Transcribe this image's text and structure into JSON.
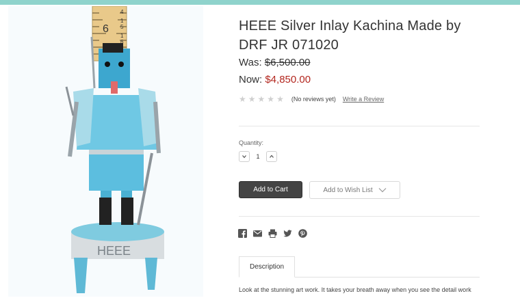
{
  "colors": {
    "accent_bar": "#8fd3cc",
    "sale_price": "#b3261e",
    "button_dark": "#444444"
  },
  "product": {
    "title_line1": "HEEE Silver Inlay Kachina Made by",
    "title_line2": "DRF JR 071020",
    "price_was_label": "Was: ",
    "price_was_value": "$6,500.00",
    "price_now_label": "Now: ",
    "price_now_value": "$4,850.00",
    "rating_stars": 0,
    "reviews_text": "(No reviews yet)",
    "write_review_label": "Write a Review",
    "image_base_inscription": "HEEE"
  },
  "ruler_marks": [
    "4",
    "1",
    "5",
    "1",
    "6"
  ],
  "quantity": {
    "label": "Quantity:",
    "value": "1",
    "decrease_icon": "chevron-down-icon",
    "increase_icon": "chevron-up-icon"
  },
  "actions": {
    "add_to_cart_label": "Add to Cart",
    "wishlist_label": "Add to Wish List"
  },
  "share_icons": [
    "facebook-icon",
    "email-icon",
    "print-icon",
    "twitter-icon",
    "pinterest-icon"
  ],
  "tabs": {
    "description_label": "Description"
  },
  "description_text": "Look at the stunning art work. It takes your breath away when you see the detail work"
}
